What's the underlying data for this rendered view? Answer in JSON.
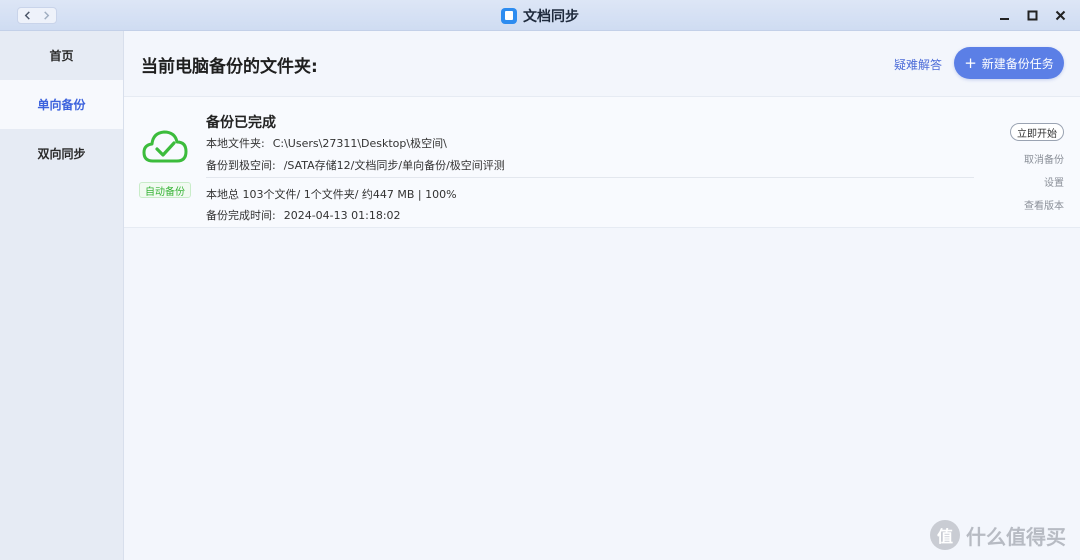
{
  "window": {
    "title": "文档同步",
    "icons": {
      "back": "chevron-left-icon",
      "forward": "chevron-right-icon",
      "minimize": "minimize-icon",
      "maximize": "maximize-icon",
      "close": "close-icon"
    }
  },
  "sidebar": {
    "items": [
      {
        "label": "首页",
        "active": false
      },
      {
        "label": "单向备份",
        "active": true
      },
      {
        "label": "双向同步",
        "active": false
      }
    ]
  },
  "main": {
    "title": "当前电脑备份的文件夹:",
    "help_link": "疑难解答",
    "new_task_button": "新建备份任务",
    "new_task_icon": "plus-icon"
  },
  "task": {
    "status": "备份已完成",
    "status_icon": "cloud-check-icon",
    "tag": "自动备份",
    "local_folder_label": "本地文件夹:",
    "local_folder_value": "C:\\Users\\27311\\Desktop\\极空间\\",
    "dest_label": "备份到极空间:",
    "dest_value": "/SATA存储12/文档同步/单向备份/极空间评测",
    "summary": "本地总 103个文件/ 1个文件夹/ 约447 MB | 100%",
    "complete_time_label": "备份完成时间:",
    "complete_time_value": "2024-04-13 01:18:02",
    "actions": {
      "start_now": "立即开始",
      "cancel": "取消备份",
      "settings": "设置",
      "versions": "查看版本"
    }
  },
  "watermark": {
    "badge": "值",
    "text": "什么值得买"
  },
  "colors": {
    "accent": "#5b7fe6",
    "active_text": "#3d63dd",
    "success": "#36b336"
  }
}
